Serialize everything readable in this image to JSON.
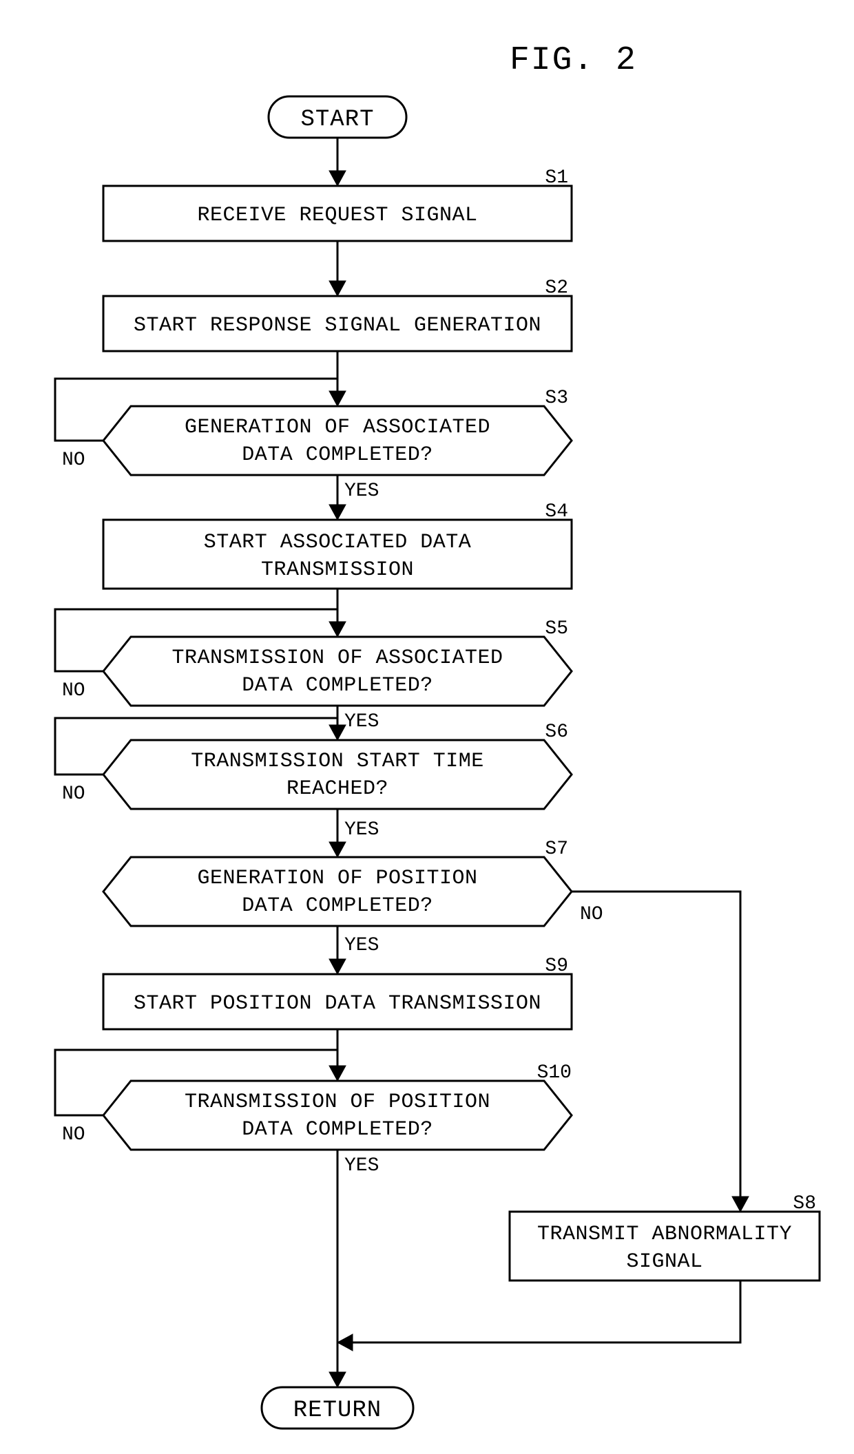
{
  "chart_data": {
    "type": "flowchart",
    "title": "FIG. 2",
    "nodes": [
      {
        "id": "start",
        "type": "terminator",
        "text": "START"
      },
      {
        "id": "s1",
        "type": "process",
        "label": "S1",
        "text": "RECEIVE REQUEST SIGNAL"
      },
      {
        "id": "s2",
        "type": "process",
        "label": "S2",
        "text": "START RESPONSE SIGNAL GENERATION"
      },
      {
        "id": "s3",
        "type": "decision",
        "label": "S3",
        "text1": "GENERATION OF ASSOCIATED",
        "text2": "DATA COMPLETED?"
      },
      {
        "id": "s4",
        "type": "process",
        "label": "S4",
        "text1": "START ASSOCIATED DATA",
        "text2": "TRANSMISSION"
      },
      {
        "id": "s5",
        "type": "decision",
        "label": "S5",
        "text1": "TRANSMISSION OF ASSOCIATED",
        "text2": "DATA COMPLETED?"
      },
      {
        "id": "s6",
        "type": "decision",
        "label": "S6",
        "text1": "TRANSMISSION START TIME",
        "text2": "REACHED?"
      },
      {
        "id": "s7",
        "type": "decision",
        "label": "S7",
        "text1": "GENERATION OF POSITION",
        "text2": "DATA COMPLETED?"
      },
      {
        "id": "s9",
        "type": "process",
        "label": "S9",
        "text": "START POSITION DATA TRANSMISSION"
      },
      {
        "id": "s10",
        "type": "decision",
        "label": "S10",
        "text1": "TRANSMISSION OF POSITION",
        "text2": "DATA COMPLETED?"
      },
      {
        "id": "s8",
        "type": "process",
        "label": "S8",
        "text1": "TRANSMIT ABNORMALITY",
        "text2": "SIGNAL"
      },
      {
        "id": "return",
        "type": "terminator",
        "text": "RETURN"
      }
    ],
    "edges": [
      {
        "from": "start",
        "to": "s1"
      },
      {
        "from": "s1",
        "to": "s2"
      },
      {
        "from": "s2",
        "to": "s3"
      },
      {
        "from": "s3",
        "to": "s4",
        "label": "YES"
      },
      {
        "from": "s3",
        "to": "s3",
        "label": "NO",
        "loop": "left"
      },
      {
        "from": "s4",
        "to": "s5"
      },
      {
        "from": "s5",
        "to": "s6",
        "label": "YES"
      },
      {
        "from": "s5",
        "to": "s5",
        "label": "NO",
        "loop": "left"
      },
      {
        "from": "s6",
        "to": "s7",
        "label": "YES"
      },
      {
        "from": "s6",
        "to": "s6",
        "label": "NO",
        "loop": "left"
      },
      {
        "from": "s7",
        "to": "s9",
        "label": "YES"
      },
      {
        "from": "s7",
        "to": "s8",
        "label": "NO",
        "side": "right"
      },
      {
        "from": "s9",
        "to": "s10"
      },
      {
        "from": "s10",
        "to": "return",
        "label": "YES"
      },
      {
        "from": "s10",
        "to": "s10",
        "label": "NO",
        "loop": "left"
      },
      {
        "from": "s8",
        "to": "return"
      }
    ]
  },
  "labels": {
    "yes": "YES",
    "no": "NO"
  }
}
